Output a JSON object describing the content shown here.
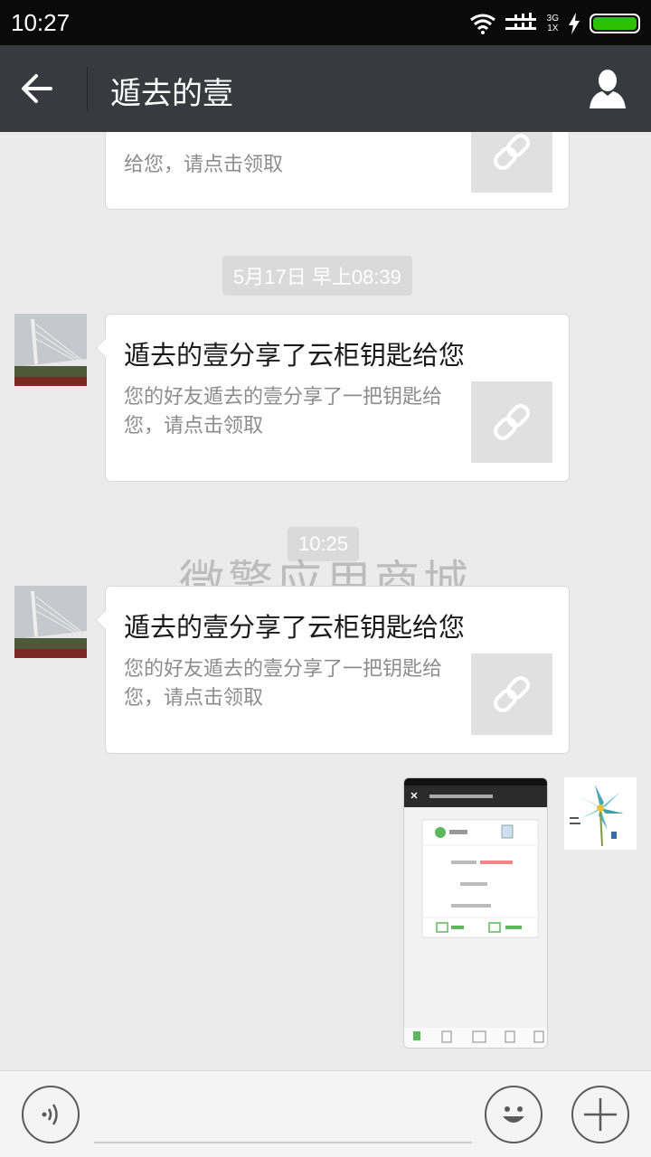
{
  "status_bar": {
    "time": "10:27",
    "network_top": "3G",
    "network_bottom": "1X",
    "icons": [
      "wifi-icon",
      "signal-icon",
      "charging-icon",
      "battery-icon"
    ],
    "battery_level": 1.0
  },
  "header": {
    "title": "遁去的壹",
    "back_icon": "arrow-left-icon",
    "profile_icon": "person-icon"
  },
  "messages": [
    {
      "type": "link_card",
      "sender": "other",
      "desc": "给您，请点击领取",
      "thumb_icon": "link-icon"
    },
    {
      "type": "timestamp",
      "text": "5月17日 早上08:39"
    },
    {
      "type": "link_card",
      "sender": "other",
      "title": "遁去的壹分享了云柜钥匙给您",
      "desc": "您的好友遁去的壹分享了一把钥匙给您，请点击领取",
      "thumb_icon": "link-icon"
    },
    {
      "type": "timestamp",
      "text": "10:25"
    },
    {
      "type": "link_card",
      "sender": "other",
      "title": "遁去的壹分享了云柜钥匙给您",
      "desc": "您的好友遁去的壹分享了一把钥匙给您，请点击领取",
      "thumb_icon": "link-icon"
    },
    {
      "type": "image",
      "sender": "self"
    }
  ],
  "watermark": "微擎应用商城",
  "input_bar": {
    "voice_icon": "voice-icon",
    "emoji_icon": "emoji-icon",
    "more_icon": "plus-icon"
  },
  "colors": {
    "title_bar": "#393a3f",
    "background": "#ebebeb",
    "battery_fill": "#2dc100"
  }
}
